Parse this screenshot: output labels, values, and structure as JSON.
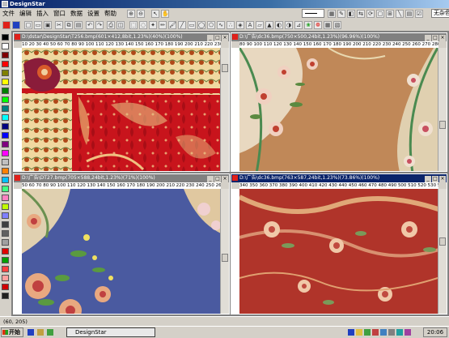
{
  "app": {
    "title": "DesignStar"
  },
  "menu": [
    "文件",
    "编辑",
    "插入",
    "窗口",
    "数据",
    "设置",
    "帮助"
  ],
  "toolbar": {
    "color_combo_value": "无杂色",
    "colors": {
      "accent_red": "#e0201a",
      "accent_green": "#20a020",
      "accent_blue": "#2040c0"
    }
  },
  "palette": {
    "swatches": [
      "#000000",
      "#ffffff",
      "#800000",
      "#ff0000",
      "#808000",
      "#ffff00",
      "#008000",
      "#00ff00",
      "#008080",
      "#00ffff",
      "#000080",
      "#0000ff",
      "#800080",
      "#ff00ff",
      "#c0c0c0",
      "#ff8000",
      "#00c0ff",
      "#40ff80",
      "#ff80c0",
      "#c0ff00",
      "#8080ff",
      "#404040",
      "#606060",
      "#a0a0a0",
      "#e00000",
      "#00a000",
      "#ff4040",
      "#ffa0a0",
      "#d00000",
      "#202020"
    ]
  },
  "windows": [
    {
      "title": "D:\\dstar\\DesignStar\\T256.bmp(601×412,8bit,1.23%)(40%)(100%)",
      "ruler": "10 20 30 40 50 60 70 80 90 100 110 120 130 140 150 160 170 180 190 200 210 220 230 240"
    },
    {
      "title": "D:\\广告\\dc36.bmp(750×500,24bit,1.23%)(96.96%)(100%)",
      "ruler": "80 90 100 110 120 130 140 150 160 170 180 190 200 210 220 230 240 250 260 270 280 290"
    },
    {
      "title": "D:\\广告\\DT27.bmp(705×588,24bit,1.23%)(71%)(100%)",
      "ruler": "50 60 70 80 90 100 110 120 130 140 150 160 170 180 190 200 210 220 230 240 250 260"
    },
    {
      "title": "D:\\广告\\dc36.bmp(763×587,24bit,1.23%)(73.86%)(100%)",
      "ruler": "340 350 360 370 380 390 400 410 420 430 440 450 460 470 480 490 500 510 520 530 540 550"
    }
  ],
  "status": {
    "coords": "(60, 205)"
  },
  "taskbar": {
    "start": "开始",
    "app": "DesignStar",
    "clock": "20:06"
  }
}
